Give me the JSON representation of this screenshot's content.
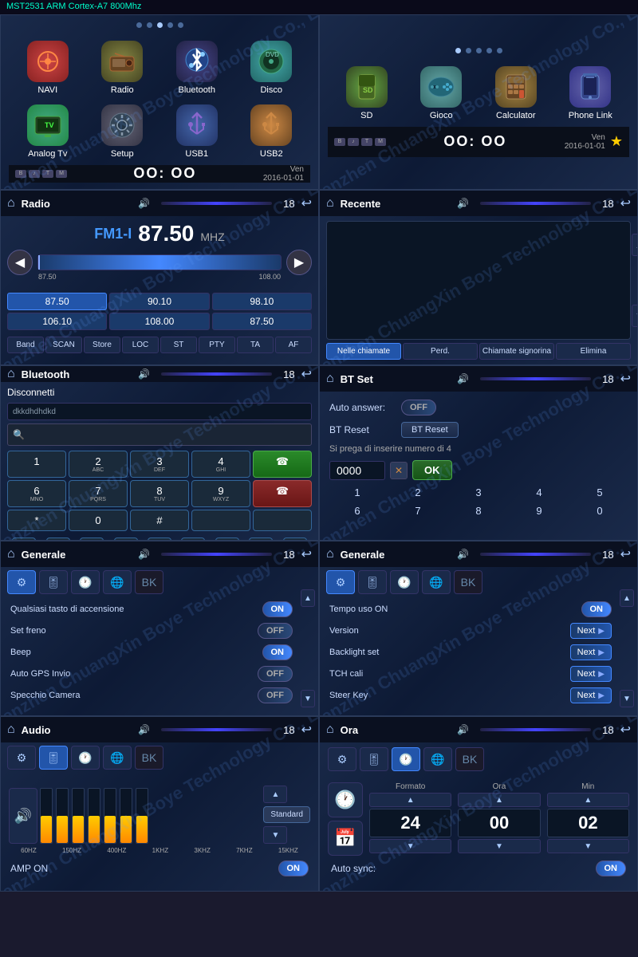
{
  "header": {
    "title": "MST2531 ARM Cortex-A7 800Mhz"
  },
  "row1_left": {
    "dots": [
      false,
      false,
      true,
      false,
      false
    ],
    "icons": [
      {
        "id": "navi",
        "label": "NAVI",
        "emoji": "🧭",
        "class": "icon-navi"
      },
      {
        "id": "radio",
        "label": "Radio",
        "emoji": "📻",
        "class": "icon-radio"
      },
      {
        "id": "bluetooth",
        "label": "Bluetooth",
        "emoji": "🎧",
        "class": "icon-bluetooth"
      },
      {
        "id": "disco",
        "label": "Disco",
        "emoji": "💿",
        "class": "icon-disco"
      },
      {
        "id": "tv",
        "label": "Analog Tv",
        "emoji": "📺",
        "class": "icon-tv"
      },
      {
        "id": "setup",
        "label": "Setup",
        "emoji": "⚙️",
        "class": "icon-setup"
      },
      {
        "id": "usb1",
        "label": "USB1",
        "emoji": "🔌",
        "class": "icon-usb1"
      },
      {
        "id": "usb2",
        "label": "USB2",
        "emoji": "🔌",
        "class": "icon-usb2"
      }
    ],
    "status": {
      "time": "OO: OO",
      "day": "Ven",
      "date": "2016-01-01"
    }
  },
  "row1_right": {
    "dots": [
      true,
      false,
      false,
      false,
      false
    ],
    "icons": [
      {
        "id": "sd",
        "label": "SD",
        "emoji": "💾",
        "class": "icon-sd"
      },
      {
        "id": "gioco",
        "label": "Gioco",
        "emoji": "🎮",
        "class": "icon-gioco"
      },
      {
        "id": "calc",
        "label": "Calculator",
        "emoji": "🧮",
        "class": "icon-calc"
      },
      {
        "id": "phone",
        "label": "Phone Link",
        "emoji": "📱",
        "class": "icon-phone"
      }
    ],
    "status": {
      "time": "OO: OO",
      "day": "Ven",
      "date": "2016-01-01",
      "star": true
    }
  },
  "radio": {
    "title": "Radio",
    "band": "FM1-I",
    "frequency": "87.50",
    "unit": "MHZ",
    "slider_min": "87.50",
    "slider_max": "108.00",
    "presets": [
      "87.50",
      "90.10",
      "98.10",
      "106.10",
      "108.00",
      "87.50"
    ],
    "active_preset": "87.50",
    "buttons": [
      "Band",
      "SCAN",
      "Store",
      "LOC",
      "ST",
      "PTY",
      "TA",
      "AF"
    ],
    "header_num": "18"
  },
  "recente": {
    "title": "Recente",
    "tabs": [
      {
        "label": "Nelle chiamate",
        "active": true
      },
      {
        "label": "Perd.",
        "active": false
      },
      {
        "label": "Chiamate signorina",
        "active": false
      },
      {
        "label": "Elimina",
        "active": false
      }
    ],
    "header_num": "18"
  },
  "bluetooth": {
    "title": "Bluetooth",
    "disconnetti": "Disconnetti",
    "device_text": "dkkdhdhdkd",
    "numpad": [
      {
        "num": "1",
        "sub": ""
      },
      {
        "num": "2",
        "sub": "ABC"
      },
      {
        "num": "3",
        "sub": "DEF"
      },
      {
        "num": "4",
        "sub": "GHI"
      },
      {
        "num": "☎",
        "sub": "",
        "green": true
      },
      {
        "num": "6",
        "sub": "MNO"
      },
      {
        "num": "7",
        "sub": "PQRS"
      },
      {
        "num": "8",
        "sub": "TUV"
      },
      {
        "num": "9",
        "sub": "WXYZ"
      },
      {
        "num": "☎",
        "sub": "",
        "red": true
      },
      {
        "num": "*",
        "sub": ""
      },
      {
        "num": "0",
        "sub": ""
      },
      {
        "num": "#",
        "sub": ""
      },
      {
        "num": "",
        "sub": ""
      },
      {
        "num": "",
        "sub": ""
      }
    ],
    "func_icons": [
      "📋",
      "⬇",
      "👤",
      "📞",
      "🔗",
      "✂️",
      "🎵",
      "📧"
    ],
    "header_num": "18"
  },
  "bt_set": {
    "title": "BT Set",
    "auto_answer_label": "Auto answer:",
    "auto_answer_state": "OFF",
    "bt_reset_label": "BT Reset",
    "bt_reset_btn": "BT Reset",
    "hint": "Si prega di inserire numero di 4",
    "code_value": "0000",
    "ok_label": "OK",
    "numrow1": [
      "1",
      "2",
      "3",
      "4",
      "5"
    ],
    "numrow2": [
      "6",
      "7",
      "8",
      "9",
      "0"
    ],
    "header_num": "18"
  },
  "generale_left": {
    "title": "Generale",
    "header_num": "18",
    "icons": [
      "⚙",
      "🎚",
      "🕐",
      "🌐",
      "BK"
    ],
    "rows": [
      {
        "label": "Qualsiasi tasto di accensione",
        "value": "ON",
        "on": true
      },
      {
        "label": "Set freno",
        "value": "OFF",
        "on": false
      },
      {
        "label": "Beep",
        "value": "ON",
        "on": true
      },
      {
        "label": "Auto GPS Invio",
        "value": "OFF",
        "on": false
      },
      {
        "label": "Specchio Camera",
        "value": "",
        "on": false,
        "no_toggle": true
      }
    ]
  },
  "generale_right": {
    "title": "Generale",
    "header_num": "18",
    "icons": [
      "⚙",
      "🎚",
      "🕐",
      "🌐",
      "BK"
    ],
    "rows": [
      {
        "label": "Tempo uso ON",
        "value": "ON",
        "on": true
      },
      {
        "label": "Version",
        "next": true
      },
      {
        "label": "Backlight set",
        "next": true
      },
      {
        "label": "TCH cali",
        "next": true
      },
      {
        "label": "Steer Key",
        "next": true
      }
    ],
    "next_label": "Next"
  },
  "audio": {
    "title": "Audio",
    "header_num": "18",
    "icons": [
      "⚙",
      "🎚",
      "🕐",
      "🌐",
      "BK"
    ],
    "eq_freqs": [
      "60HZ",
      "150HZ",
      "400HZ",
      "1KHZ",
      "3KHZ",
      "7KHZ",
      "15KHZ"
    ],
    "eq_levels": [
      50,
      50,
      50,
      50,
      50,
      50,
      50
    ],
    "mode": "Standard",
    "amp_on_label": "AMP ON",
    "amp_on_value": "ON"
  },
  "ora": {
    "title": "Ora",
    "header_num": "18",
    "icons": [
      "⚙",
      "🎚",
      "🕐",
      "🌐",
      "BK"
    ],
    "formato_label": "Formato",
    "ora_label": "Ora",
    "min_label": "Min",
    "formato_value": "24",
    "ora_value": "00",
    "min_value": "02",
    "auto_sync_label": "Auto sync:",
    "auto_sync_value": "ON",
    "auto_sync_on": true
  }
}
